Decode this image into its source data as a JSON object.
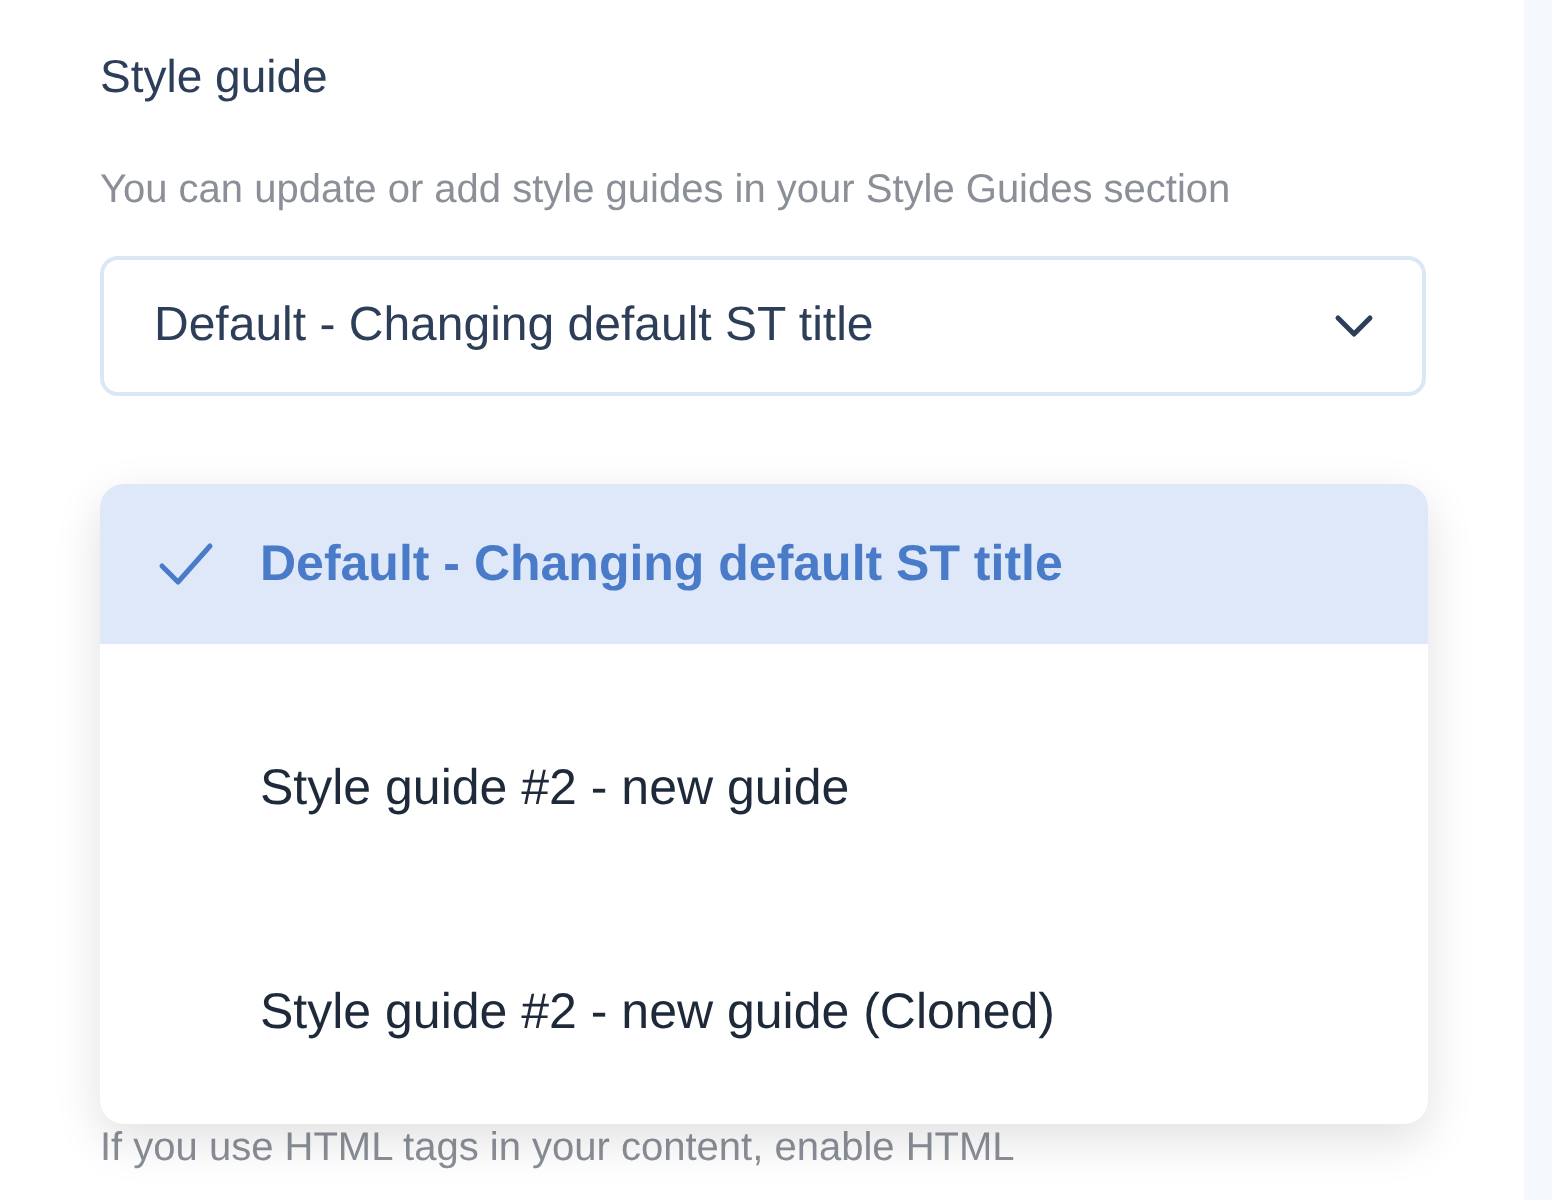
{
  "section": {
    "title": "Style guide",
    "description": "You can update or add style guides in your Style Guides section"
  },
  "select": {
    "value": "Default - Changing default ST title",
    "expanded": true,
    "options": [
      {
        "label": "Default - Changing default ST title",
        "selected": true
      },
      {
        "label": "Style guide #2 - new guide",
        "selected": false
      },
      {
        "label": "Style guide #2 - new guide (Cloned)",
        "selected": false
      }
    ]
  },
  "next_hint": "If you use HTML tags in your content, enable HTML"
}
